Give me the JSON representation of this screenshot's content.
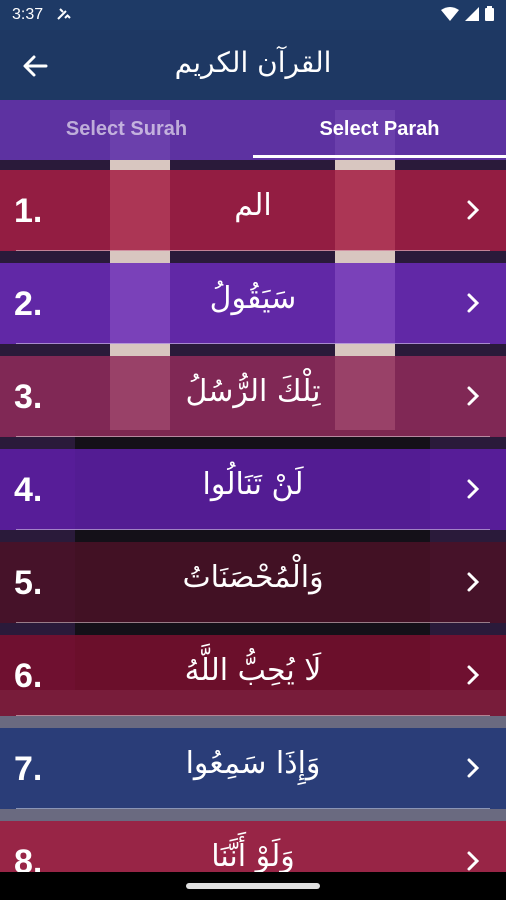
{
  "status_bar": {
    "time": "3:37",
    "notification_icon": "tools-icon",
    "wifi_icon": "wifi-icon",
    "signal_icon": "signal-icon",
    "battery_icon": "battery-icon"
  },
  "app_bar": {
    "back_icon": "arrow-left-icon",
    "title": "القرآن الكريم"
  },
  "tabs": [
    {
      "label": "Select Surah",
      "selected": false
    },
    {
      "label": "Select Parah",
      "selected": true
    }
  ],
  "parahs": [
    {
      "number": "1.",
      "name": "الم",
      "color": "#a41e44"
    },
    {
      "number": "2.",
      "name": "سَيَقُولُ",
      "color": "#6a2bb8"
    },
    {
      "number": "3.",
      "name": "تِلْكَ الرُّسُلُ",
      "color": "#8e2b5a"
    },
    {
      "number": "4.",
      "name": "لَنْ تَنَالُوا",
      "color": "#5e1ea8"
    },
    {
      "number": "5.",
      "name": "وَالْمُحْصَنَاتُ",
      "color": "#4a1226"
    },
    {
      "number": "6.",
      "name": "لَا يُحِبُّ اللَّهُ",
      "color": "#7a0f2e"
    },
    {
      "number": "7.",
      "name": "وَإِذَا سَمِعُوا",
      "color": "#1f3577"
    },
    {
      "number": "8.",
      "name": "وَلَوْ أَنَّنَا",
      "color": "#a01a3c"
    }
  ],
  "chevron_icon": "chevron-right-icon"
}
